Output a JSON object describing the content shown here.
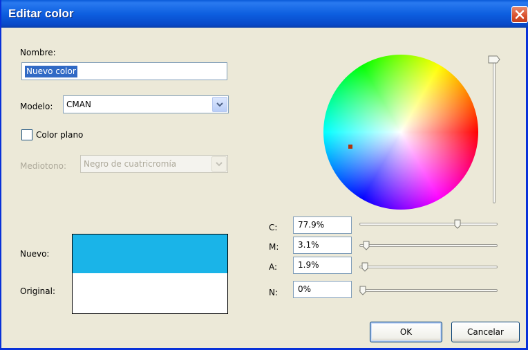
{
  "window": {
    "title": "Editar color"
  },
  "name": {
    "label": "Nombre:",
    "value": "Nuevo color"
  },
  "model": {
    "label": "Modelo:",
    "value": "CMAN"
  },
  "spot_color": {
    "label": "Color plano",
    "checked": false
  },
  "halftone": {
    "label": "Mediotono:",
    "value": "Negro de cuatricromía",
    "enabled": false
  },
  "preview": {
    "new_label": "Nuevo:",
    "original_label": "Original:",
    "new_color": "#1ab4e8",
    "original_color": "#ffffff"
  },
  "channels": [
    {
      "label": "C:",
      "value": "77.9%",
      "level": 0.779
    },
    {
      "label": "M:",
      "value": "3.1%",
      "level": 0.031
    },
    {
      "label": "A:",
      "value": "1.9%",
      "level": 0.019
    },
    {
      "label": "N:",
      "value": "0%",
      "level": 0
    }
  ],
  "brightness_level": 1.0,
  "buttons": {
    "ok": "OK",
    "cancel": "Cancelar"
  },
  "icons": {
    "close": "close-icon",
    "dropdown": "chevron-down-icon"
  },
  "colors": {
    "titlebar": "#0d5fe0",
    "dialog_bg": "#ece9d8",
    "marker": "#b0360d"
  }
}
